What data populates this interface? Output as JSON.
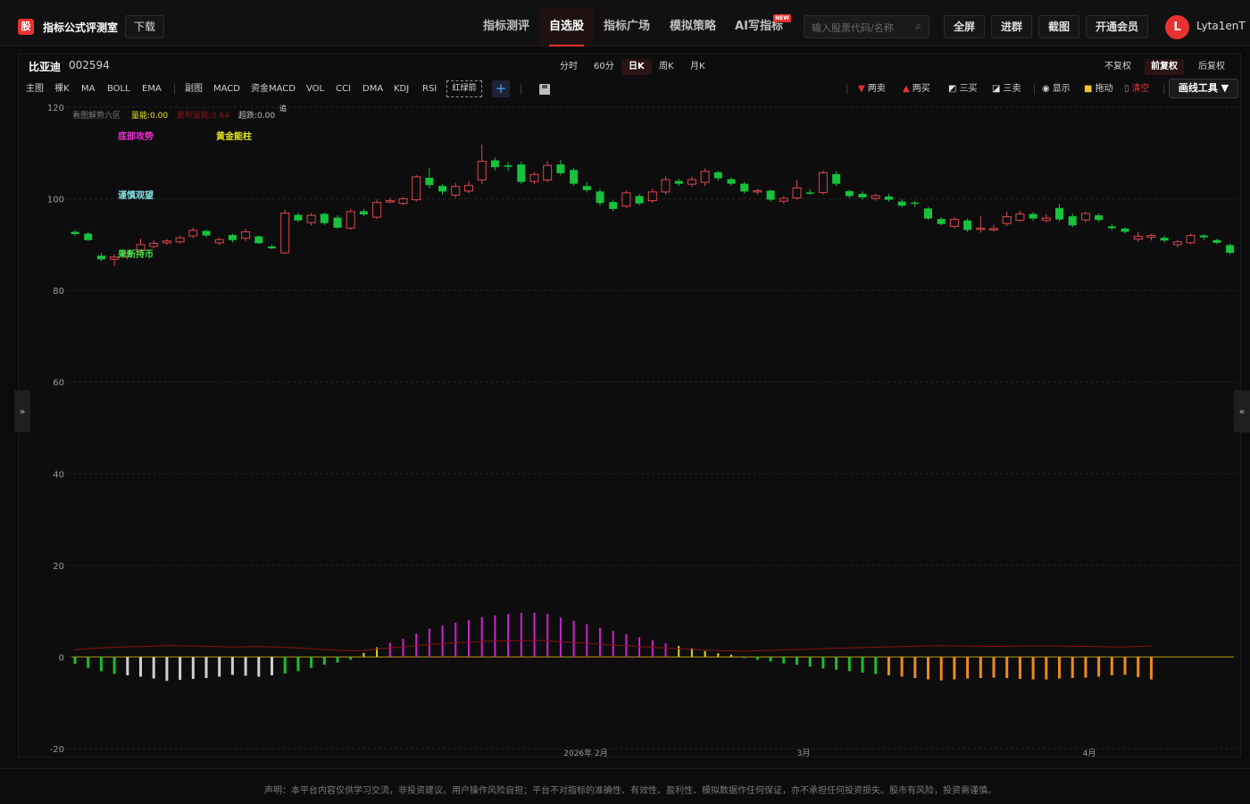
{
  "header": {
    "logo_char": "股",
    "brand": "指标公式评测室",
    "download": "下载",
    "nav": [
      "指标测评",
      "自选股",
      "指标广场",
      "模拟策略",
      "AI写指标"
    ],
    "new_badge": "NEW",
    "search_placeholder": "输入股票代码/名称",
    "buttons": [
      "全屏",
      "进群",
      "截图",
      "开通会员"
    ],
    "avatar_letter": "L",
    "username": "Lyta1enT"
  },
  "stock": {
    "name": "比亚迪",
    "code": "002594"
  },
  "periods": [
    "分时",
    "60分",
    "日K",
    "周K",
    "月K"
  ],
  "adjust": [
    "不复权",
    "前复权",
    "后复权"
  ],
  "indicators": [
    "主图",
    "裸K",
    "MA",
    "BOLL",
    "EMA",
    "副图",
    "MACD",
    "资金MACD",
    "VOL",
    "CCI",
    "DMA",
    "KDJ",
    "RSI"
  ],
  "selected_indicator": "红绿箭",
  "tools": [
    "两卖",
    "两买",
    "三买",
    "三卖",
    "显示",
    "拖动",
    "清空"
  ],
  "draw_tool": "画线工具 ▼",
  "side_left": "»",
  "side_right": "«",
  "footer_text": "声明：本平台内容仅供学习交流，非投资建议。用户操作风险自担；平台不对指标的准确性、有效性、盈利性、模拟数据作任何保证，亦不承担任何投资损失。股市有风险，投资需谨慎。",
  "legend": {
    "l1": "看图解势六区",
    "l2": "量能:0.00",
    "l3": "累积量能:0.64",
    "l4": "超跌:0.00",
    "l5": "追"
  },
  "annotations": [
    "底部攻势",
    "黄金能柱",
    "谨慎观望",
    "果断持币"
  ],
  "colors": {
    "up": "#e0474c",
    "down": "#17c23d",
    "accent": "#e8322f"
  },
  "chart_data": {
    "type": "candlestick",
    "ylim": [
      -20,
      120
    ],
    "yticks": [
      120,
      100,
      80,
      60,
      40,
      20,
      0,
      -20
    ],
    "xticks": [
      "2026年 2月",
      "3月",
      "4月"
    ],
    "candles": [
      [
        92.8,
        92.3,
        93.2,
        91.9
      ],
      [
        92.4,
        91.0,
        92.8,
        90.8
      ],
      [
        87.6,
        86.8,
        88.2,
        86.4
      ],
      [
        86.8,
        87.3,
        88.0,
        85.4
      ],
      [
        87.4,
        88.2,
        88.6,
        86.8
      ],
      [
        88.8,
        90.0,
        91.3,
        88.1
      ],
      [
        89.6,
        90.3,
        91.0,
        89.2
      ],
      [
        90.4,
        90.8,
        91.2,
        89.9
      ],
      [
        90.6,
        91.5,
        92.0,
        90.2
      ],
      [
        91.9,
        93.1,
        93.7,
        91.4
      ],
      [
        93.0,
        92.0,
        93.3,
        91.6
      ],
      [
        90.4,
        91.1,
        91.6,
        89.9
      ],
      [
        92.1,
        91.0,
        92.4,
        90.5
      ],
      [
        91.4,
        92.8,
        93.5,
        90.8
      ],
      [
        91.8,
        90.3,
        92.0,
        90.1
      ],
      [
        89.6,
        89.2,
        90.0,
        89.0
      ],
      [
        88.2,
        96.9,
        97.6,
        88.0
      ],
      [
        96.5,
        95.3,
        97.0,
        94.9
      ],
      [
        94.8,
        96.4,
        96.9,
        94.2
      ],
      [
        96.7,
        94.7,
        97.0,
        94.3
      ],
      [
        95.9,
        93.7,
        96.4,
        93.5
      ],
      [
        93.6,
        97.2,
        97.8,
        93.3
      ],
      [
        97.3,
        96.6,
        97.8,
        96.2
      ],
      [
        96.0,
        99.2,
        99.9,
        95.6
      ],
      [
        99.4,
        99.6,
        100.2,
        99.0
      ],
      [
        99.0,
        100.0,
        100.4,
        98.6
      ],
      [
        99.8,
        104.8,
        105.2,
        99.4
      ],
      [
        104.6,
        103.0,
        106.7,
        102.3
      ],
      [
        102.8,
        101.6,
        103.2,
        100.9
      ],
      [
        100.8,
        102.7,
        103.5,
        100.2
      ],
      [
        101.7,
        102.9,
        103.9,
        101.2
      ],
      [
        104.1,
        108.2,
        111.8,
        103.2
      ],
      [
        108.4,
        106.9,
        109.0,
        106.2
      ],
      [
        107.3,
        107.0,
        108.0,
        106.1
      ],
      [
        107.5,
        103.7,
        108.1,
        103.3
      ],
      [
        103.8,
        105.3,
        105.9,
        103.2
      ],
      [
        104.1,
        107.3,
        108.2,
        103.6
      ],
      [
        107.5,
        105.6,
        108.5,
        105.1
      ],
      [
        106.3,
        103.3,
        106.8,
        102.9
      ],
      [
        102.8,
        101.9,
        103.7,
        101.4
      ],
      [
        101.6,
        99.1,
        102.1,
        98.5
      ],
      [
        99.3,
        97.8,
        99.7,
        97.3
      ],
      [
        98.4,
        101.3,
        101.8,
        98.0
      ],
      [
        100.6,
        99.0,
        101.1,
        98.6
      ],
      [
        99.6,
        101.5,
        102.2,
        99.1
      ],
      [
        101.5,
        104.2,
        104.9,
        101.0
      ],
      [
        103.9,
        103.3,
        104.4,
        102.8
      ],
      [
        103.2,
        104.2,
        104.8,
        102.6
      ],
      [
        103.6,
        106.0,
        106.6,
        102.8
      ],
      [
        105.8,
        104.5,
        106.1,
        104.0
      ],
      [
        104.3,
        103.3,
        104.7,
        102.9
      ],
      [
        103.3,
        101.6,
        103.7,
        101.2
      ],
      [
        101.5,
        101.8,
        102.2,
        100.9
      ],
      [
        101.8,
        99.8,
        102.0,
        99.4
      ],
      [
        99.5,
        100.1,
        100.6,
        98.9
      ],
      [
        100.2,
        102.4,
        104.2,
        99.8
      ],
      [
        101.4,
        101.3,
        102.1,
        100.9
      ],
      [
        101.4,
        105.7,
        106.2,
        100.9
      ],
      [
        105.4,
        103.3,
        106.0,
        102.8
      ],
      [
        101.7,
        100.6,
        102.0,
        100.1
      ],
      [
        101.1,
        100.3,
        101.6,
        99.8
      ],
      [
        100.1,
        100.7,
        101.1,
        99.6
      ],
      [
        100.5,
        99.8,
        101.1,
        99.4
      ],
      [
        99.4,
        98.5,
        99.9,
        98.1
      ],
      [
        99.2,
        98.9,
        99.6,
        98.2
      ],
      [
        97.9,
        95.7,
        98.2,
        95.4
      ],
      [
        95.6,
        94.5,
        96.0,
        94.2
      ],
      [
        94.0,
        95.5,
        96.0,
        93.5
      ],
      [
        95.3,
        93.2,
        95.7,
        92.8
      ],
      [
        93.4,
        93.6,
        96.3,
        92.6
      ],
      [
        93.2,
        93.5,
        94.4,
        92.9
      ],
      [
        94.6,
        96.1,
        97.2,
        94.0
      ],
      [
        95.3,
        96.7,
        97.4,
        95.0
      ],
      [
        96.7,
        95.7,
        97.1,
        95.2
      ],
      [
        95.3,
        95.8,
        96.6,
        94.8
      ],
      [
        98.0,
        95.5,
        98.9,
        95.1
      ],
      [
        96.2,
        94.2,
        96.8,
        93.8
      ],
      [
        95.4,
        96.8,
        97.2,
        94.8
      ],
      [
        96.4,
        95.4,
        96.8,
        95.0
      ],
      [
        94.0,
        93.6,
        94.4,
        93.2
      ],
      [
        93.5,
        92.8,
        93.8,
        92.4
      ],
      [
        91.2,
        91.8,
        92.8,
        90.6
      ],
      [
        91.6,
        92.0,
        92.4,
        90.9
      ],
      [
        91.5,
        90.9,
        91.9,
        90.5
      ],
      [
        90.0,
        90.6,
        91.0,
        89.4
      ],
      [
        90.4,
        92.0,
        92.4,
        90.0
      ],
      [
        92.0,
        91.6,
        92.3,
        91.0
      ],
      [
        91.0,
        90.4,
        91.3,
        90.1
      ],
      [
        89.9,
        88.2,
        90.2,
        87.9
      ]
    ],
    "sub_histogram": [
      -1.5,
      -2.4,
      -3.1,
      -3.7,
      -4.0,
      -4.3,
      -4.7,
      -5.2,
      -5.0,
      -4.8,
      -4.6,
      -4.3,
      -3.9,
      -4.1,
      -4.3,
      -4.0,
      -3.6,
      -3.1,
      -2.4,
      -1.7,
      -1.2,
      -0.6,
      0.9,
      2.1,
      3.1,
      4.0,
      5.1,
      6.2,
      6.9,
      7.5,
      8.1,
      8.7,
      9.1,
      9.4,
      9.6,
      9.7,
      9.4,
      8.6,
      7.9,
      7.1,
      6.4,
      5.7,
      5.0,
      4.3,
      3.7,
      3.0,
      2.4,
      1.9,
      1.3,
      0.8,
      0.5,
      -0.2,
      -0.6,
      -1.0,
      -1.4,
      -1.7,
      -2.1,
      -2.5,
      -2.8,
      -3.1,
      -3.4,
      -3.7,
      -4.0,
      -4.3,
      -4.6,
      -4.9,
      -5.1,
      -4.9,
      -4.7,
      -4.6,
      -4.5,
      -4.6,
      -4.8,
      -4.9,
      -4.9,
      -4.7,
      -4.6,
      -4.5,
      -4.3,
      -4.0,
      -3.9,
      -4.4,
      -4.9
    ]
  }
}
